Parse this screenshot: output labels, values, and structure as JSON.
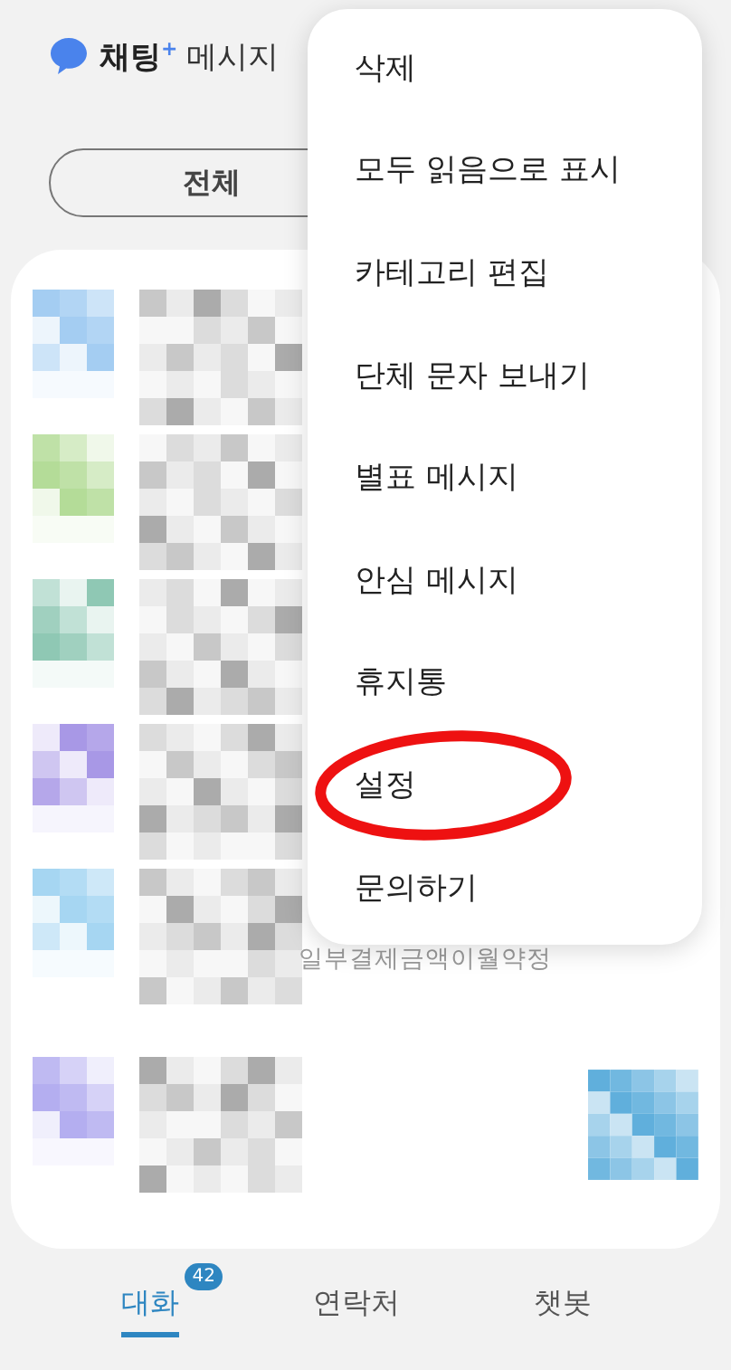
{
  "header": {
    "brand": "채팅$^{+}$",
    "title": "메시지"
  },
  "filters": [
    {
      "label": "전체",
      "selected": true
    }
  ],
  "conversations": [
    {
      "color": "#a4cdf2"
    },
    {
      "color": "#b4dc98"
    },
    {
      "color": "#8fc8b4"
    },
    {
      "color": "#a898e6"
    },
    {
      "color": "#a6d6f2",
      "preview": "일부결제금액이월약정"
    },
    {
      "color": "#b4aef0",
      "thumbnail": true
    }
  ],
  "menu": [
    {
      "label": "삭제",
      "circled": false
    },
    {
      "label": "모두 읽음으로 표시",
      "circled": false
    },
    {
      "label": "카테고리 편집",
      "circled": false
    },
    {
      "label": "단체 문자 보내기",
      "circled": false
    },
    {
      "label": "별표 메시지",
      "circled": false
    },
    {
      "label": "안심 메시지",
      "circled": false
    },
    {
      "label": "휴지통",
      "circled": false
    },
    {
      "label": "설정",
      "circled": true
    },
    {
      "label": "문의하기",
      "circled": false
    }
  ],
  "bottom_tabs": [
    {
      "label": "대화",
      "selected": true,
      "badge": "42"
    },
    {
      "label": "연락처",
      "selected": false
    },
    {
      "label": "챗봇",
      "selected": false
    }
  ]
}
